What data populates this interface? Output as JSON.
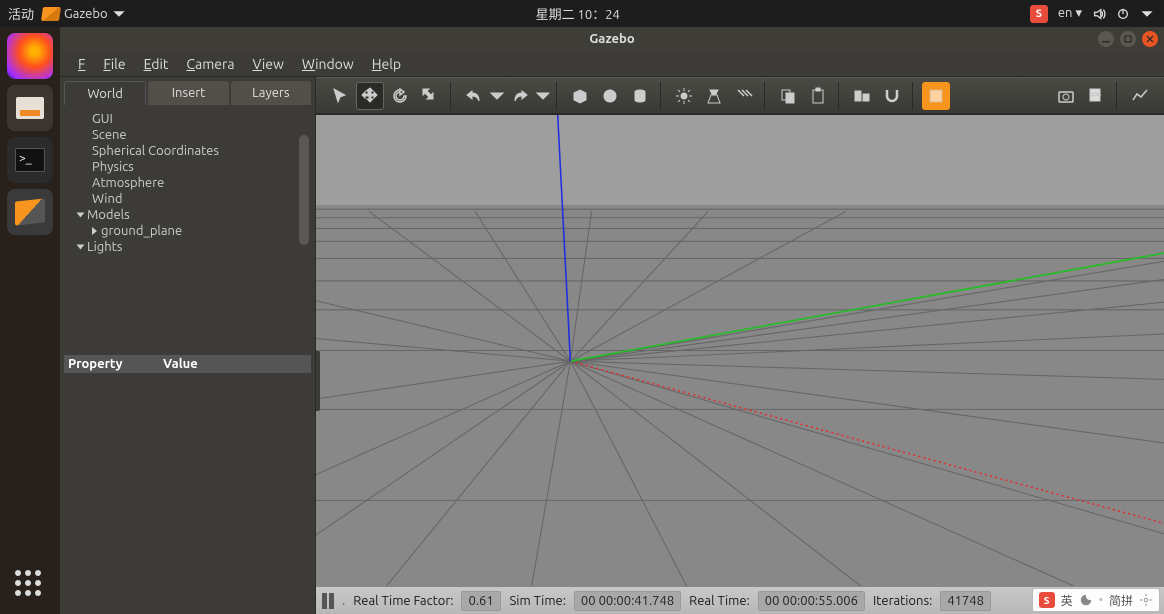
{
  "topbar": {
    "activities": "活动",
    "app_name": "Gazebo",
    "datetime": "星期二 10：24",
    "lang": "en"
  },
  "window": {
    "title": "Gazebo"
  },
  "menu": {
    "file": "File",
    "edit": "Edit",
    "camera": "Camera",
    "view": "View",
    "window": "Window",
    "help": "Help"
  },
  "sidebar": {
    "tabs": [
      "World",
      "Insert",
      "Layers"
    ],
    "tree": {
      "gui": "GUI",
      "scene": "Scene",
      "spherical": "Spherical Coordinates",
      "physics": "Physics",
      "atmosphere": "Atmosphere",
      "wind": "Wind",
      "models": "Models",
      "ground_plane": "ground_plane",
      "lights": "Lights"
    },
    "prop_header": {
      "property": "Property",
      "value": "Value"
    }
  },
  "status": {
    "rtf_label": "Real Time Factor:",
    "rtf_value": "0.61",
    "sim_label": "Sim Time:",
    "sim_value": "00 00:00:41.748",
    "real_label": "Real Time:",
    "real_value": "00 00:00:55.006",
    "iter_label": "Iterations:",
    "iter_value": "41748"
  },
  "ime": {
    "label1": "英",
    "label2": "简拼"
  }
}
